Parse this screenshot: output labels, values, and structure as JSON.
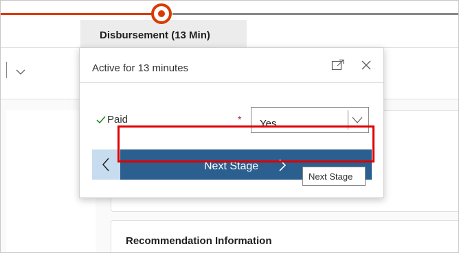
{
  "process_bar": {
    "active_stage_label": "Disbursement  (13 Min)"
  },
  "flyout": {
    "title": "Active for 13 minutes",
    "icons": [
      "dock-icon",
      "close-icon"
    ],
    "field": {
      "label": "Paid",
      "required_marker": "*",
      "value": "Yes",
      "completed_icon": "check-icon"
    },
    "prev_icon": "chevron-left-icon",
    "next_button_label": "Next Stage",
    "next_icon": "chevron-right-icon"
  },
  "tooltip": {
    "text": "Next Stage"
  },
  "background": {
    "section_title": "Recommendation Information"
  },
  "colors": {
    "accent_orange": "#d83b01",
    "next_button": "#2b5f8f",
    "prev_button": "#c7dcef",
    "highlight_red": "#e00000"
  }
}
